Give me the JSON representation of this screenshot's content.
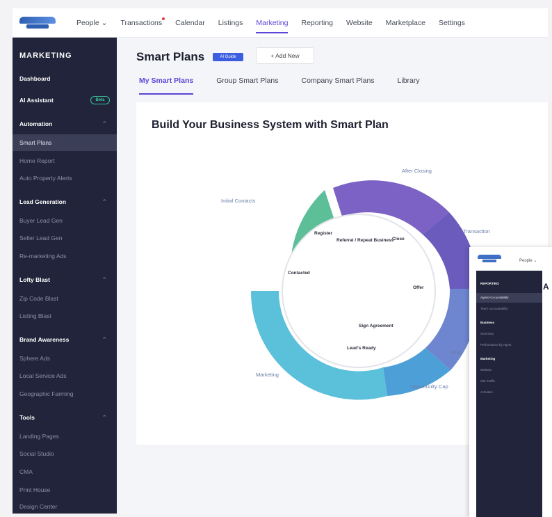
{
  "topnav": {
    "items": [
      {
        "label": "People ⌄"
      },
      {
        "label": "Transactions"
      },
      {
        "label": "Calendar"
      },
      {
        "label": "Listings"
      },
      {
        "label": "Marketing"
      },
      {
        "label": "Reporting"
      },
      {
        "label": "Website"
      },
      {
        "label": "Marketplace"
      },
      {
        "label": "Settings"
      }
    ]
  },
  "sidebar": {
    "title": "MARKETING",
    "dashboard": "Dashboard",
    "ai_assistant": "AI Assistant",
    "ai_badge": "Beta",
    "automation": "Automation",
    "automation_items": [
      "Smart Plans",
      "Home Report",
      "Auto Property Alerts"
    ],
    "lead_generation": "Lead Generation",
    "lead_items": [
      "Buyer Lead Gen",
      "Seller Lead Gen",
      "Re-marketing Ads"
    ],
    "lofty_blast": "Lofty Blast",
    "blast_items": [
      "Zip Code Blast",
      "Listing Blast"
    ],
    "brand_awareness": "Brand Awareness",
    "brand_items": [
      "Sphere Ads",
      "Local Service Ads",
      "Geographic Farming"
    ],
    "tools": "Tools",
    "tools_items": [
      "Landing Pages",
      "Social Studio",
      "CMA",
      "Print House",
      "Design Center"
    ]
  },
  "main": {
    "title": "Smart Plans",
    "guide_badge": "AI Guide",
    "add_new": "+ Add New",
    "tabs": [
      "My Smart Plans",
      "Group Smart Plans",
      "Company Smart Plans",
      "Library"
    ],
    "panel_title": "Build Your Business System with Smart Plan"
  },
  "diagram": {
    "outer_segments": [
      {
        "label": "Initial Contacts",
        "color": "#5cbf98"
      },
      {
        "label": "After Closing",
        "color": "#7b62c4"
      },
      {
        "label": "Transaction",
        "color": "#6a5bbd"
      },
      {
        "label": "Prop",
        "color": "#6d86cf"
      },
      {
        "label": "Opportunity Cap",
        "color": "#4d9fd8"
      },
      {
        "label": "Marketing",
        "color": "#5bc0da"
      }
    ],
    "inner_labels": [
      "Register",
      "Referral / Repeat Business",
      "Close",
      "Contacted",
      "Offer",
      "Sign Agreement",
      "Lead's Ready"
    ]
  },
  "overlay": {
    "people": "People ⌄",
    "main_letter": "A",
    "rows": [
      "REPORTING",
      "Agent Accountability",
      "Team Accountability",
      "Business",
      "Summary",
      "Performance by Agent",
      "Marketing",
      "Website",
      "Site Traffic",
      "Activities"
    ]
  }
}
